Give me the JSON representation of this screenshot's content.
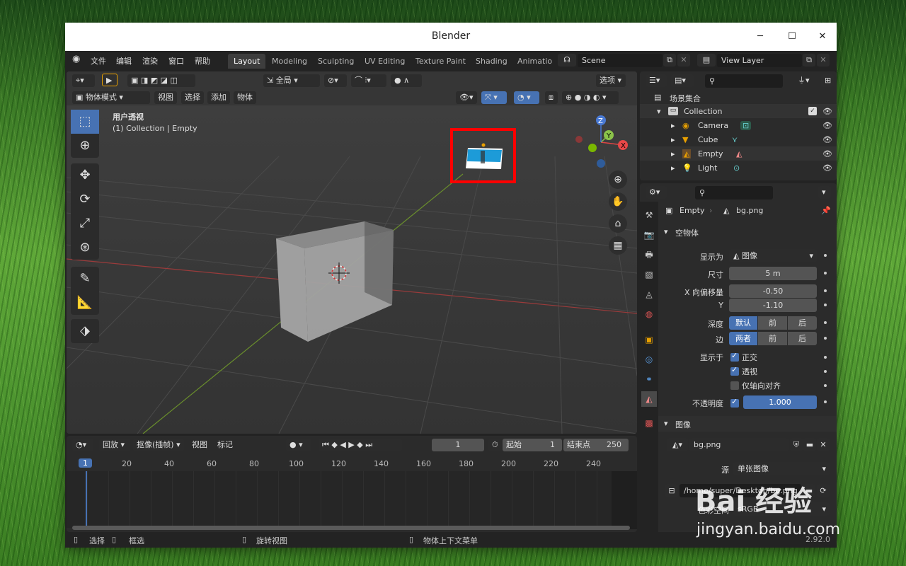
{
  "window": {
    "title": "Blender"
  },
  "menu": [
    "文件",
    "编辑",
    "渲染",
    "窗口",
    "帮助"
  ],
  "workspaces": [
    "Layout",
    "Modeling",
    "Sculpting",
    "UV Editing",
    "Texture Paint",
    "Shading",
    "Animatio"
  ],
  "scene": "Scene",
  "view_layer": "View Layer",
  "viewport": {
    "orientation": "全局",
    "options": "选项",
    "mode": "物体模式",
    "menus": [
      "视图",
      "选择",
      "添加",
      "物体"
    ],
    "info_title": "用户透视",
    "info_sub": "(1) Collection | Empty",
    "gizmo": {
      "z": "Z",
      "y": "Y",
      "x": "X"
    }
  },
  "timeline": {
    "menus": [
      "回放",
      "抠像(插帧)",
      "视图",
      "标记"
    ],
    "current_frame": "1",
    "start_label": "起始",
    "start": "1",
    "end_label": "结束点",
    "end": "250",
    "ruler": [
      "1",
      "20",
      "40",
      "60",
      "80",
      "100",
      "120",
      "140",
      "160",
      "180",
      "200",
      "220",
      "240"
    ]
  },
  "outliner": {
    "root": "场景集合",
    "collection": "Collection",
    "items": [
      "Camera",
      "Cube",
      "Empty",
      "Light"
    ]
  },
  "properties": {
    "breadcrumb_object": "Empty",
    "breadcrumb_data": "bg.png",
    "panel_empty": "空物体",
    "display_as_label": "显示为",
    "display_as": "图像",
    "size_label": "尺寸",
    "size": "5 m",
    "offset_x_label": "X 向偏移量",
    "offset_x": "-0.50",
    "offset_y_label": "Y",
    "offset_y": "-1.10",
    "depth_label": "深度",
    "depth_options": [
      "默认",
      "前",
      "后"
    ],
    "side_label": "边",
    "side_options": [
      "两者",
      "前",
      "后"
    ],
    "show_in_label": "显示于",
    "show_ortho": "正交",
    "show_persp": "透视",
    "show_axis": "仅轴向对齐",
    "opacity_label": "不透明度",
    "opacity": "1.000",
    "panel_image": "图像",
    "image_name": "bg.png",
    "source_label": "源",
    "source": "单张图像",
    "filepath": "/home/super/Desktop/bg.png",
    "colorspace_label": "色彩空间",
    "colorspace": "sRGB"
  },
  "status": {
    "select": "选择",
    "box_select": "框选",
    "rotate": "旋转视图",
    "context_menu": "物体上下文菜单",
    "version": "2.92.0"
  },
  "watermark": {
    "brand": "Bai 经验",
    "url": "jingyan.baidu.com"
  }
}
